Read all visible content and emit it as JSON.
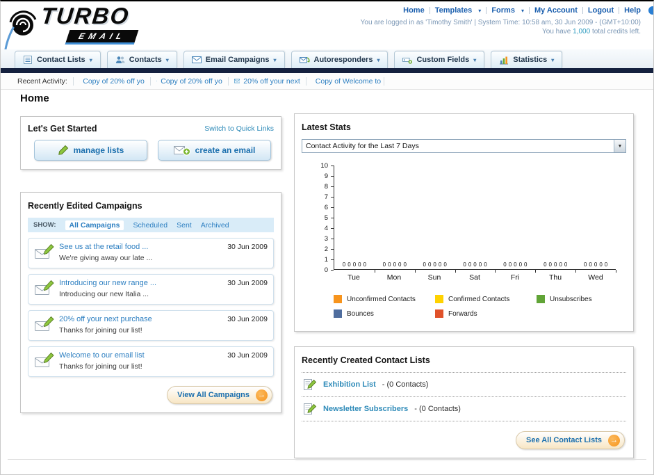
{
  "header": {
    "logo": {
      "line1": "TURBO",
      "line2": "EMAIL"
    },
    "links": [
      "Home",
      "Templates",
      "Forms",
      "My Account",
      "Logout",
      "Help"
    ],
    "session_line": "You are logged in as 'Timothy Smith' | System Time: 10:58 am, 30 Jun 2009 - (GMT+10:00)",
    "credits_prefix": "You have ",
    "credits_value": "1,000",
    "credits_suffix": " total credits left."
  },
  "nav": {
    "tabs": [
      "Contact Lists",
      "Contacts",
      "Email Campaigns",
      "Autoresponders",
      "Custom Fields",
      "Statistics"
    ]
  },
  "activity": {
    "label": "Recent Activity:",
    "items": [
      "Copy of 20% off yo",
      "Copy of 20% off yo",
      "20% off your next",
      "Copy of Welcome to"
    ]
  },
  "page": {
    "title": "Home"
  },
  "get_started": {
    "title": "Let's Get Started",
    "switch_link": "Switch to Quick Links",
    "manage_lists_label": "manage lists",
    "create_email_label": "create an email"
  },
  "campaigns": {
    "title": "Recently Edited Campaigns",
    "show_label": "SHOW:",
    "filters": [
      "All Campaigns",
      "Scheduled",
      "Sent",
      "Archived"
    ],
    "active_filter": "All Campaigns",
    "items": [
      {
        "title": "See us at the retail food ...",
        "subtitle": "We're giving away our late ...",
        "date": "30 Jun 2009"
      },
      {
        "title": "Introducing our new range ...",
        "subtitle": "Introducing our new Italia ...",
        "date": "30 Jun 2009"
      },
      {
        "title": "20% off your next purchase",
        "subtitle": "Thanks for joining our list!",
        "date": "30 Jun 2009"
      },
      {
        "title": "Welcome to our email list",
        "subtitle": "Thanks for joining our list!",
        "date": "30 Jun 2009"
      }
    ],
    "view_all_label": "View All Campaigns"
  },
  "stats": {
    "title": "Latest Stats",
    "dropdown_value": "Contact Activity for the Last 7 Days"
  },
  "chart_data": {
    "type": "bar",
    "title": "Contact Activity for the Last 7 Days",
    "categories": [
      "Tue",
      "Mon",
      "Sun",
      "Sat",
      "Fri",
      "Thu",
      "Wed"
    ],
    "series": [
      {
        "name": "Unconfirmed Contacts",
        "color": "#f7941d",
        "values": [
          0,
          0,
          0,
          0,
          0,
          0,
          0
        ]
      },
      {
        "name": "Confirmed Contacts",
        "color": "#ffd200",
        "values": [
          0,
          0,
          0,
          0,
          0,
          0,
          0
        ]
      },
      {
        "name": "Unsubscribes",
        "color": "#61a437",
        "values": [
          0,
          0,
          0,
          0,
          0,
          0,
          0
        ]
      },
      {
        "name": "Bounces",
        "color": "#4f6d9e",
        "values": [
          0,
          0,
          0,
          0,
          0,
          0,
          0
        ]
      },
      {
        "name": "Forwards",
        "color": "#e0522a",
        "values": [
          0,
          0,
          0,
          0,
          0,
          0,
          0
        ]
      }
    ],
    "ylim": [
      0,
      10
    ],
    "yticks": [
      0,
      1,
      2,
      3,
      4,
      5,
      6,
      7,
      8,
      9,
      10
    ],
    "legend_position": "bottom",
    "grid": false
  },
  "contact_lists": {
    "title": "Recently Created Contact Lists",
    "items": [
      {
        "name": "Exhibition List",
        "suffix": " - (0 Contacts)"
      },
      {
        "name": "Newsletter Subscribers",
        "suffix": " - (0 Contacts)"
      }
    ],
    "see_all_label": "See All Contact Lists"
  }
}
